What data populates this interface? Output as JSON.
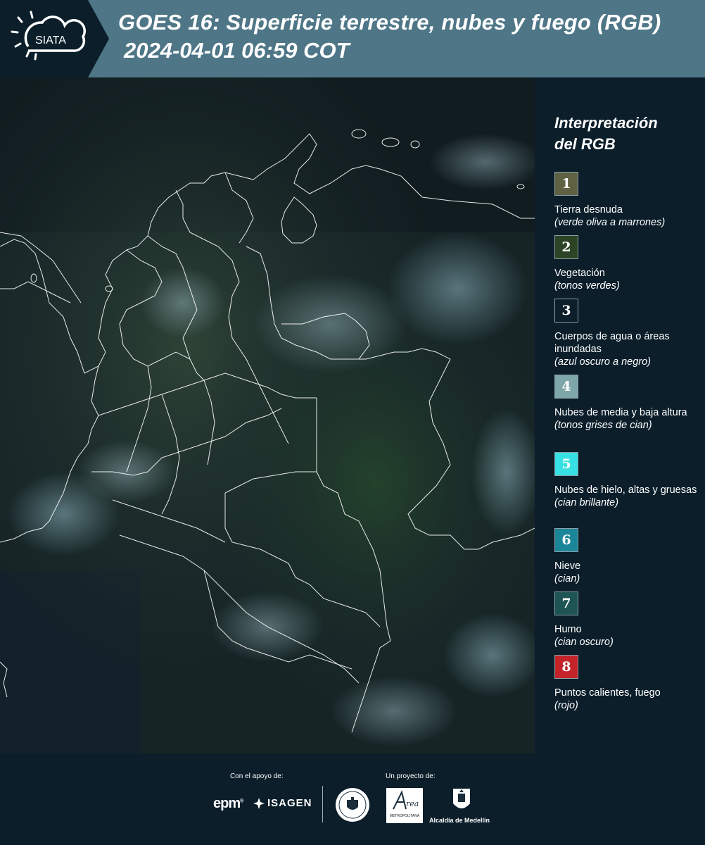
{
  "header": {
    "logo_text": "SIATA",
    "title_line1": "GOES 16: Superficie terrestre, nubes y fuego (RGB)",
    "title_line2": "2024-04-01 06:59 COT"
  },
  "legend": {
    "title_line1": "Interpretación",
    "title_line2": "del RGB",
    "items": [
      {
        "number": "1",
        "color": "#5e6142",
        "label": "Tierra desnuda",
        "note": "(verde oliva a marrones)"
      },
      {
        "number": "2",
        "color": "#2c4425",
        "label": "Vegetación",
        "note": "(tonos verdes)"
      },
      {
        "number": "3",
        "color": "#0b1e2a",
        "label": "Cuerpos de agua o áreas inundadas",
        "note": "(azul oscuro a negro)"
      },
      {
        "number": "4",
        "color": "#7fa6a8",
        "label": "Nubes de media y baja altura",
        "note": "(tonos grises de cian)"
      },
      {
        "number": "5",
        "color": "#36e0e3",
        "label": "Nubes de hielo, altas y gruesas",
        "note": "(cian brillante)"
      },
      {
        "number": "6",
        "color": "#1b8698",
        "label": "Nieve",
        "note": "(cian)"
      },
      {
        "number": "7",
        "color": "#1e5454",
        "label": "Humo",
        "note": "(cian oscuro)"
      },
      {
        "number": "8",
        "color": "#c4232a",
        "label": "Puntos calientes, fuego",
        "note": "(rojo)"
      }
    ]
  },
  "footer": {
    "support_label": "Con el apoyo de:",
    "project_label": "Un proyecto de:",
    "epm_logo": "epm",
    "isagen_logo": "ISAGEN",
    "area_logo_text": "METROPOLITANA",
    "medellin_label": "Alcaldía de Medellín"
  }
}
